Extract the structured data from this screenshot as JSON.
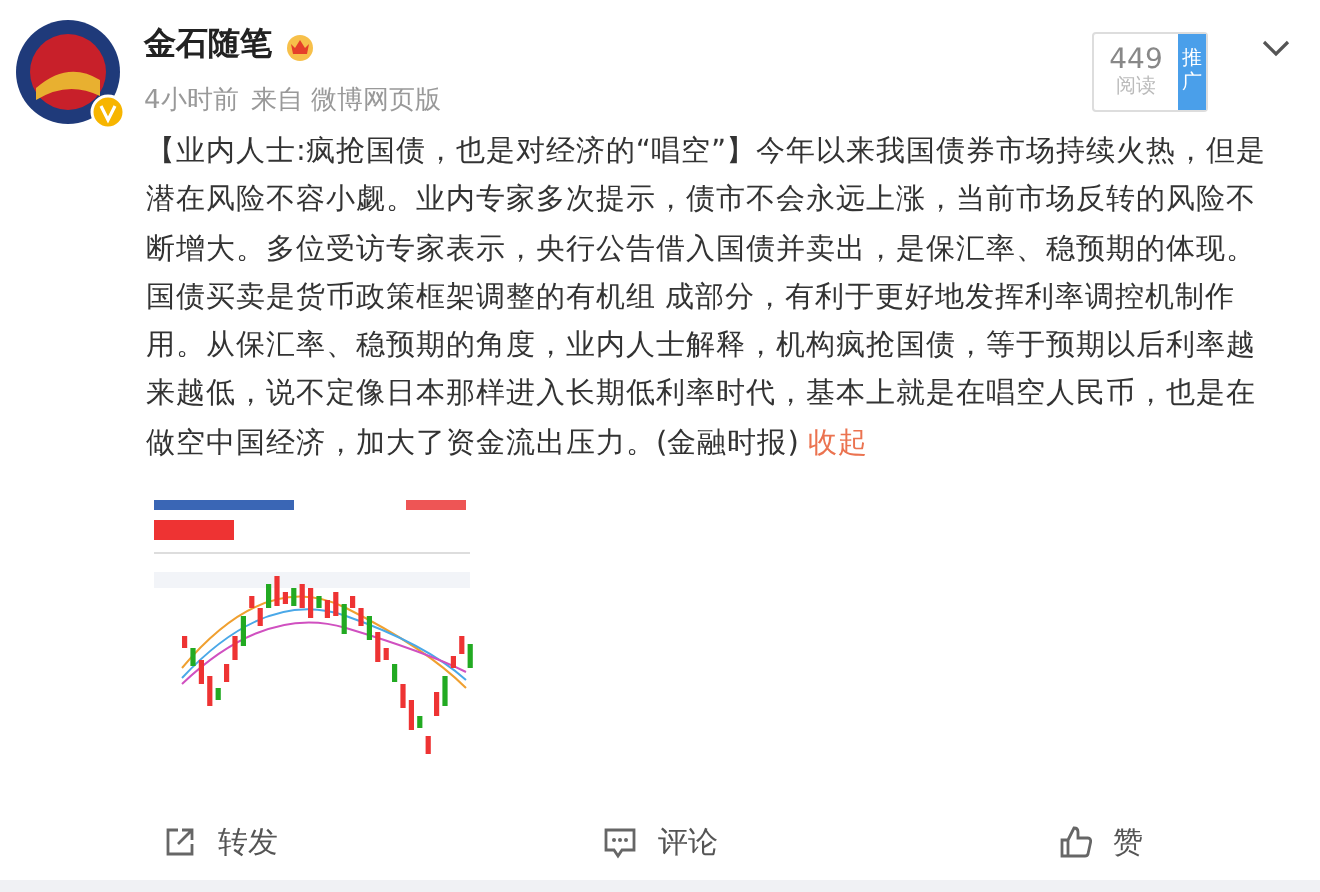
{
  "author": {
    "name": "金石随笔",
    "verified": true
  },
  "meta": {
    "time": "4小时前",
    "source": "来自 微博网页版"
  },
  "stats": {
    "count": "449",
    "count_label": "阅读",
    "promote": "推广"
  },
  "post": {
    "text": "【业内人士:疯抢国债，也是对经济的“唱空”】今年以来我国债券市场持续火热，但是潜在风险不容小觑。业内专家多次提示，债市不会永远上涨，当前市场反转的风险不断增大。多位受访专家表示，央行公告借入国债并卖出，是保汇率、稳预期的体现。国债买卖是货币政策框架调整的有机组 成部分，有利于更好地发挥利率调控机制作用。从保汇率、稳预期的角度，业内人士解释，机构疯抢国债，等于预期以后利率越来越低，说不定像日本那样进入长期低利率时代，基本上就是在唱空人民币，也是在做空中国经济，加大了资金流出压力。(金融时报)",
    "collapse_link": "收起"
  },
  "actions": [
    {
      "kind": "repost",
      "label": "转发"
    },
    {
      "kind": "comment",
      "label": "评论"
    },
    {
      "kind": "like",
      "label": "赞"
    }
  ]
}
